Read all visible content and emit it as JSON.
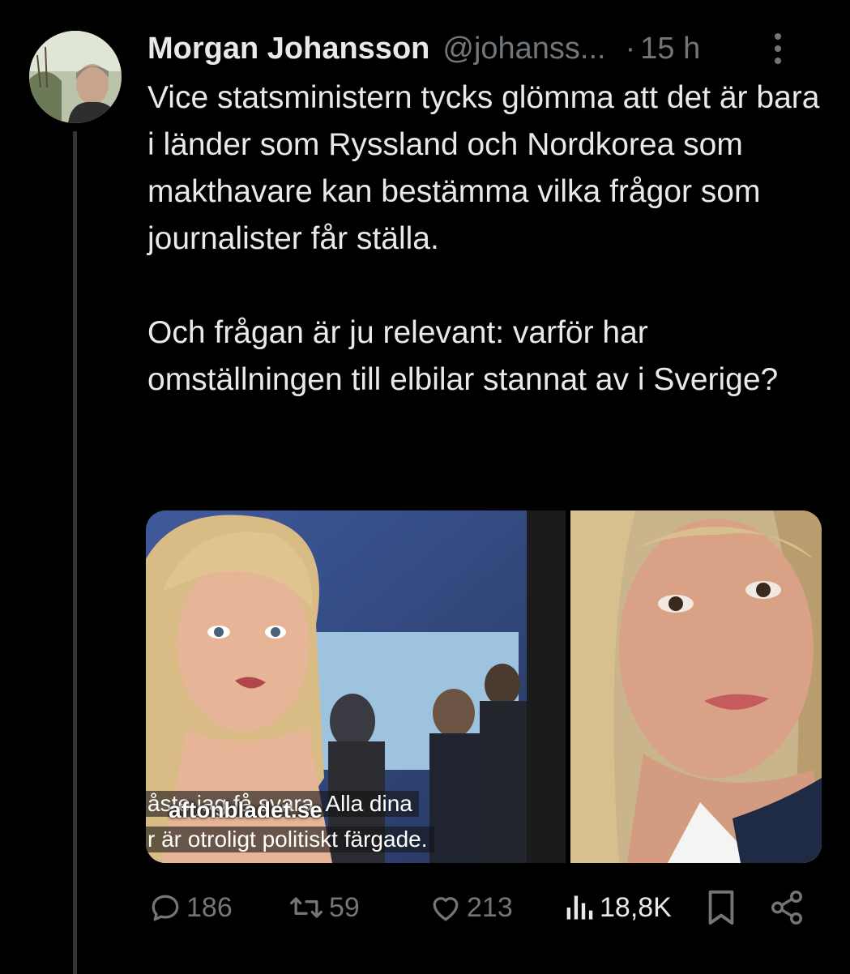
{
  "tweet": {
    "author": {
      "display_name": "Morgan Johansson",
      "handle": "@johanss...",
      "separator": "·",
      "time": "15 h"
    },
    "text": {
      "paragraph1": "Vice statsministern tycks glömma att det är bara i länder som Ryssland och Nordkorea som makthavare kan bestämma vilka frågor som journalister får ställa.",
      "paragraph2": "Och frågan är ju relevant: varför har omställningen till elbilar stannat av i Sverige?"
    },
    "media": {
      "subtitle_line1_a": "åste jag få svara. Alla",
      "subtitle_line1_b": " dina",
      "subtitle_line2": "r är otroligt politiskt färgade.",
      "source_label": "aftonbladet.se"
    },
    "actions": {
      "replies": "186",
      "reposts": "59",
      "likes": "213",
      "views": "18,8K"
    },
    "icons": {
      "more": "more-options-icon",
      "reply": "reply-icon",
      "repost": "repost-icon",
      "like": "heart-icon",
      "views": "views-chart-icon",
      "bookmark": "bookmark-icon",
      "share": "share-icon"
    },
    "colors": {
      "background": "#000000",
      "text_primary": "#e7e9ea",
      "text_secondary": "#71767b",
      "thread_line": "#333639"
    }
  }
}
